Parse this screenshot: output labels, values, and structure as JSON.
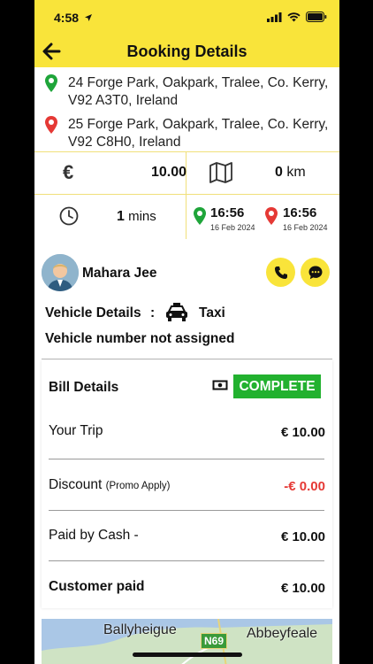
{
  "status_bar": {
    "time": "4:58"
  },
  "header": {
    "title": "Booking Details"
  },
  "route": {
    "pickup": "24 Forge Park, Oakpark, Tralee, Co. Kerry, V92 A3T0, Ireland",
    "dropoff": "25 Forge Park, Oakpark, Tralee, Co. Kerry, V92 C8H0, Ireland"
  },
  "trip": {
    "currency_symbol": "€",
    "fare": "10.00",
    "distance_value": "0",
    "distance_unit": "km",
    "duration_value": "1",
    "duration_unit": "mins",
    "start_time": "16:56",
    "start_date": "16 Feb 2024",
    "end_time": "16:56",
    "end_date": "16 Feb 2024"
  },
  "driver": {
    "name": "Mahara Jee"
  },
  "vehicle": {
    "label": "Vehicle Details",
    "colon": ":",
    "type": "Taxi",
    "number_text": "Vehicle number not assigned"
  },
  "bill": {
    "title": "Bill Details",
    "status": "COMPLETE",
    "rows": [
      {
        "label": "Your Trip",
        "note": "",
        "value": "€ 10.00"
      },
      {
        "label": "Discount",
        "note": "(Promo Apply)",
        "value": "-€ 0.00"
      },
      {
        "label": "Paid by Cash -",
        "note": "",
        "value": "€ 10.00"
      },
      {
        "label": "Customer paid",
        "note": "",
        "value": "€ 10.00"
      }
    ]
  },
  "map": {
    "place_left": "Ballyheigue",
    "road_label": "N69",
    "place_right": "Abbeyfeale"
  },
  "colors": {
    "accent_yellow": "#f9e43a",
    "complete_green": "#22b12f",
    "pickup_pin": "#1fa53a",
    "dropoff_pin": "#e53935",
    "discount_red": "#e53935"
  },
  "icons": [
    "location-arrow-icon",
    "signal-icon",
    "wifi-icon",
    "battery-icon",
    "back-arrow-icon",
    "pickup-pin-icon",
    "dropoff-pin-icon",
    "euro-icon",
    "map-icon",
    "clock-icon",
    "avatar",
    "phone-icon",
    "chat-icon",
    "taxi-icon",
    "cash-icon"
  ]
}
